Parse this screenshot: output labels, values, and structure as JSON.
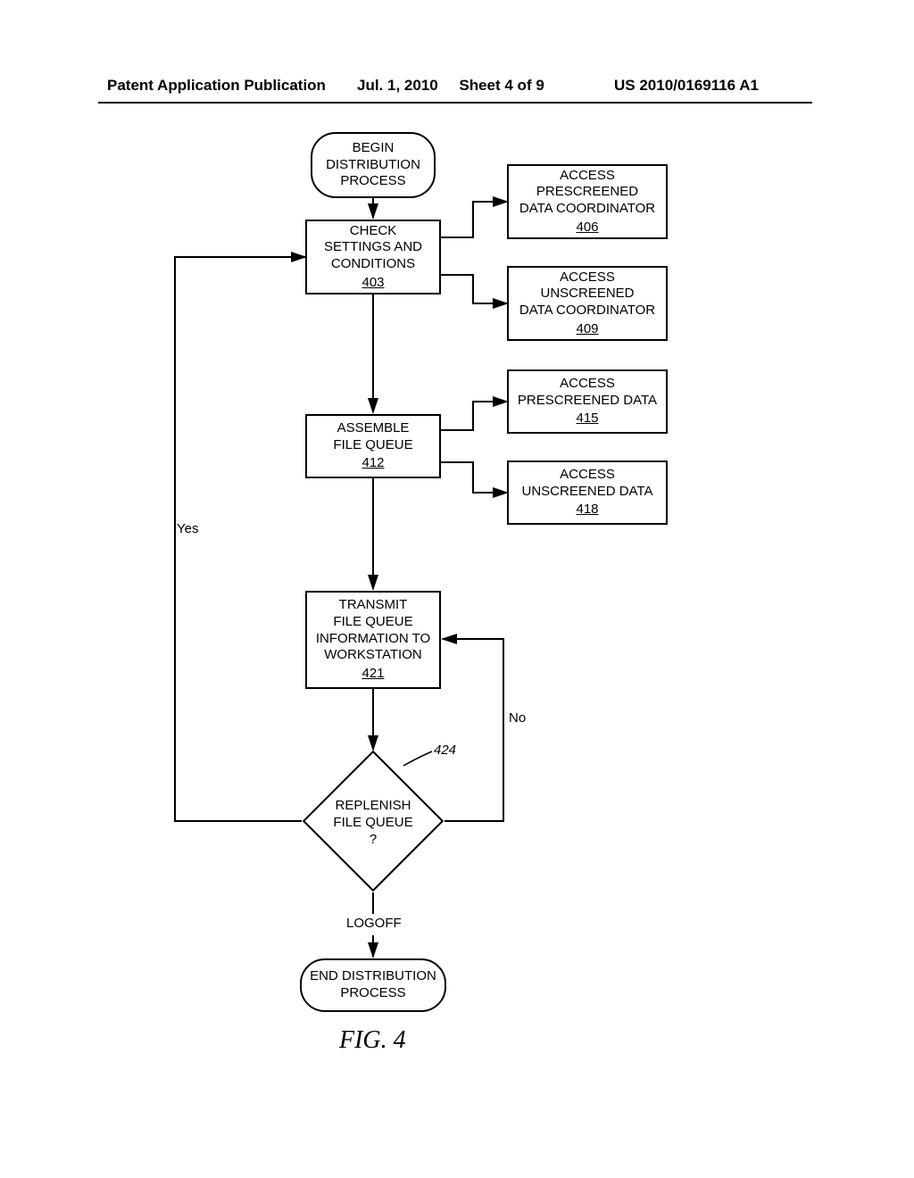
{
  "header": {
    "left": "Patent Application Publication",
    "mid_date": "Jul. 1, 2010",
    "mid_sheet": "Sheet 4 of 9",
    "right": "US 2010/0169116 A1"
  },
  "blocks": {
    "begin": "BEGIN\nDISTRIBUTION\nPROCESS",
    "b403_text": "CHECK\nSETTINGS AND\nCONDITIONS",
    "b403_ref": "403",
    "b406_text": "ACCESS\nPRESCREENED\nDATA COORDINATOR",
    "b406_ref": "406",
    "b409_text": "ACCESS\nUNSCREENED\nDATA COORDINATOR",
    "b409_ref": "409",
    "b412_text": "ASSEMBLE\nFILE QUEUE",
    "b412_ref": "412",
    "b415_text": "ACCESS\nPRESCREENED DATA",
    "b415_ref": "415",
    "b418_text": "ACCESS\nUNSCREENED DATA",
    "b418_ref": "418",
    "b421_text": "TRANSMIT\nFILE QUEUE\nINFORMATION TO\nWORKSTATION",
    "b421_ref": "421",
    "d424_text": "REPLENISH\nFILE QUEUE\n?",
    "d424_ref": "424",
    "logoff": "LOGOFF",
    "end": "END DISTRIBUTION\nPROCESS",
    "yes": "Yes",
    "no": "No"
  },
  "figure_label": "FIG. 4"
}
